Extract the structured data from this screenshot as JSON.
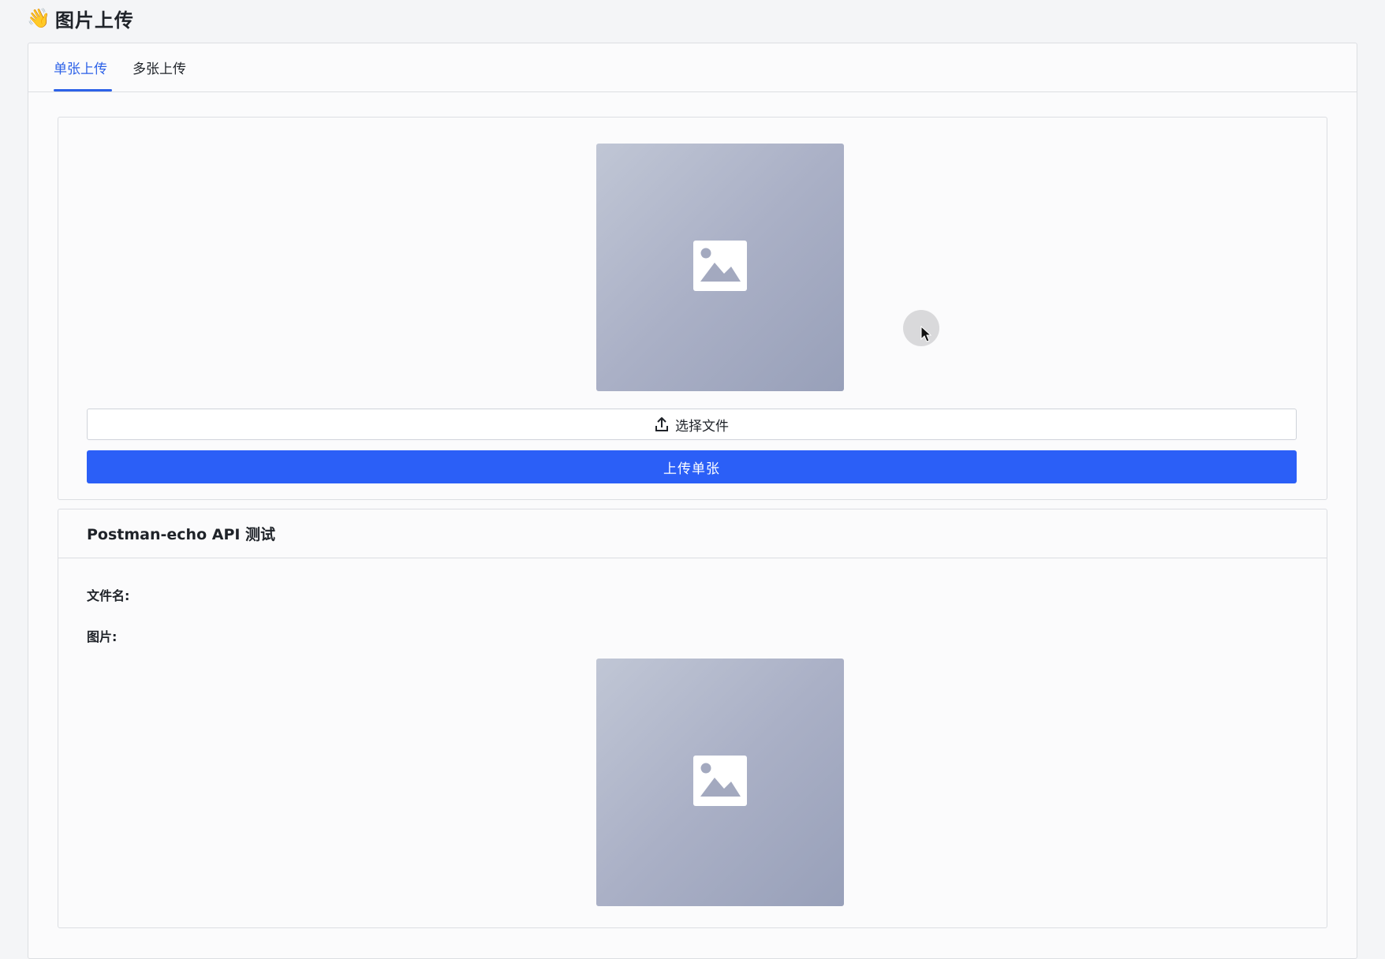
{
  "header": {
    "emoji": "👋",
    "title": "图片上传"
  },
  "tabs": [
    {
      "label": "单张上传",
      "active": true
    },
    {
      "label": "多张上传",
      "active": false
    }
  ],
  "upload_section": {
    "preview_icon": "image-icon",
    "select_button_icon": "upload-icon",
    "select_button_label": "选择文件",
    "upload_button_label": "上传单张"
  },
  "api_section": {
    "title": "Postman-echo API 测试",
    "filename_label": "文件名:",
    "filename_value": "",
    "image_label": "图片:",
    "preview_icon": "image-icon"
  },
  "colors": {
    "accent": "#2d62e8",
    "primary_button": "#2b5ff7",
    "background": "#f4f5f7",
    "card": "#fbfbfc",
    "border": "#dcdee2"
  }
}
